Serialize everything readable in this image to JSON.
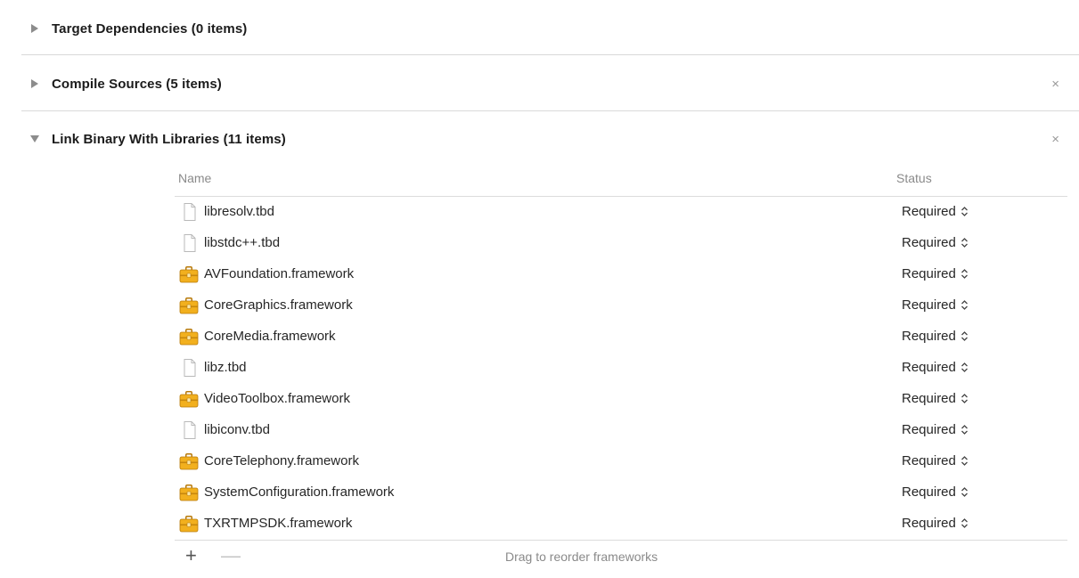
{
  "phases": {
    "target_dependencies": {
      "title": "Target Dependencies (0 items)"
    },
    "compile_sources": {
      "title": "Compile Sources (5 items)",
      "close_symbol": "×"
    },
    "link_binary": {
      "title": "Link Binary With Libraries (11 items)",
      "close_symbol": "×"
    }
  },
  "libraries": {
    "columns": {
      "name": "Name",
      "status": "Status"
    },
    "rows": [
      {
        "name": "libresolv.tbd",
        "status": "Required",
        "icon": "file-icon"
      },
      {
        "name": "libstdc++.tbd",
        "status": "Required",
        "icon": "file-icon"
      },
      {
        "name": "AVFoundation.framework",
        "status": "Required",
        "icon": "framework-toolbox-icon"
      },
      {
        "name": "CoreGraphics.framework",
        "status": "Required",
        "icon": "framework-toolbox-icon"
      },
      {
        "name": "CoreMedia.framework",
        "status": "Required",
        "icon": "framework-toolbox-icon"
      },
      {
        "name": "libz.tbd",
        "status": "Required",
        "icon": "file-icon"
      },
      {
        "name": "VideoToolbox.framework",
        "status": "Required",
        "icon": "framework-toolbox-icon"
      },
      {
        "name": "libiconv.tbd",
        "status": "Required",
        "icon": "file-icon"
      },
      {
        "name": "CoreTelephony.framework",
        "status": "Required",
        "icon": "framework-toolbox-icon"
      },
      {
        "name": "SystemConfiguration.framework",
        "status": "Required",
        "icon": "framework-toolbox-icon"
      },
      {
        "name": "TXRTMPSDK.framework",
        "status": "Required",
        "icon": "framework-toolbox-icon"
      }
    ],
    "footer": {
      "add_symbol": "+",
      "remove_symbol": "—",
      "hint": "Drag to reorder frameworks"
    }
  },
  "colors": {
    "disclosure": "#8c8c8c",
    "separator": "#d9d9d9",
    "toolbox_body": "#f2b01e",
    "toolbox_dark": "#b87a0a"
  }
}
